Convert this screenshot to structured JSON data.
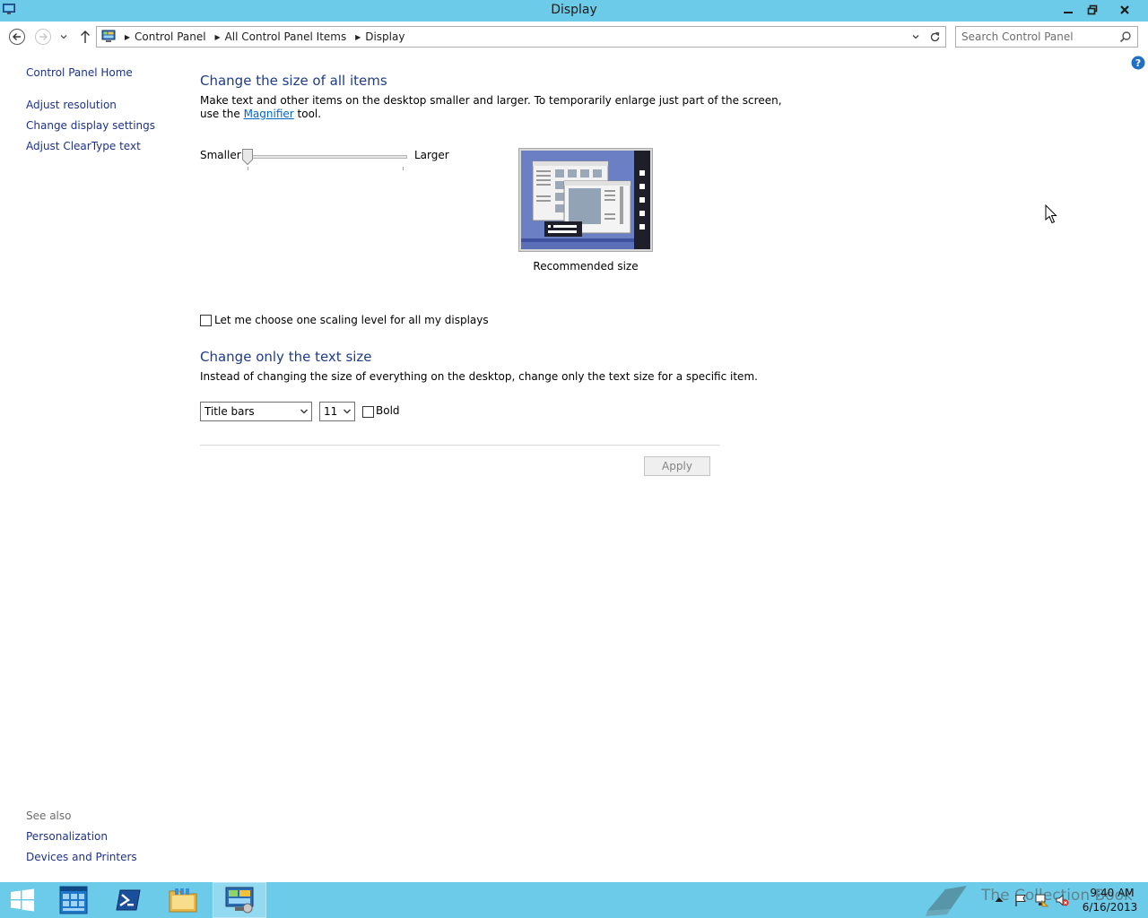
{
  "window": {
    "title": "Display"
  },
  "address": {
    "crumbs": [
      "Control Panel",
      "All Control Panel Items",
      "Display"
    ],
    "search_placeholder": "Search Control Panel"
  },
  "left_pane": {
    "links": [
      "Control Panel Home",
      "Adjust resolution",
      "Change display settings",
      "Adjust ClearType text"
    ],
    "see_also_label": "See also",
    "see_also_links": [
      "Personalization",
      "Devices and Printers"
    ]
  },
  "main": {
    "size_heading": "Change the size of all items",
    "size_desc_line1": "Make text and other items on the desktop smaller and larger. To temporarily enlarge just part of the screen,",
    "size_desc_line2_pre": "use the ",
    "magnifier_link": "Magnifier",
    "size_desc_line2_post": " tool.",
    "slider_smaller": "Smaller",
    "slider_larger": "Larger",
    "slider_level": 0,
    "preview_caption": "Recommended size",
    "one_scaling_label": "Let me choose one scaling level for all my displays",
    "one_scaling_checked": false,
    "text_heading": "Change only the text size",
    "text_desc": "Instead of changing the size of everything on the desktop, change only the text size for a specific item.",
    "item_select_value": "Title bars",
    "size_select_value": "11",
    "bold_label": "Bold",
    "bold_checked": false,
    "apply_label": "Apply"
  },
  "taskbar": {
    "watermark": "The Collection Book",
    "time": "9:40 AM",
    "date": "6/16/2013"
  },
  "colors": {
    "titlebar": "#6ccbe9",
    "heading": "#1e3c87",
    "link": "#1e3287"
  }
}
